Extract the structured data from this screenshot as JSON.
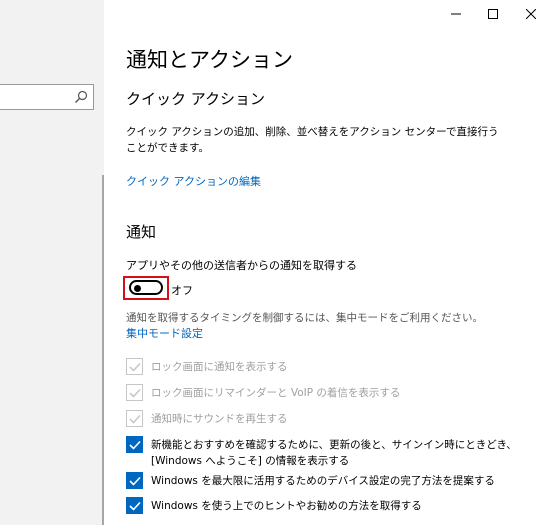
{
  "sidebar": {
    "search_icon": "search-icon"
  },
  "window": {
    "minimize_icon": "minimize-icon",
    "maximize_icon": "maximize-icon",
    "close_icon": "close-icon"
  },
  "page": {
    "title": "通知とアクション"
  },
  "quick_actions": {
    "heading": "クイック アクション",
    "description": "クイック アクションの追加、削除、並べ替えをアクション センターで直接行うことができます。",
    "edit_link": "クイック アクションの編集"
  },
  "notifications": {
    "heading": "通知",
    "toggle_label": "アプリやその他の送信者からの通知を取得する",
    "toggle_state": "オフ",
    "toggle_on": false,
    "focus_hint": "通知を取得するタイミングを制御するには、集中モードをご利用ください。",
    "focus_link": "集中モード設定",
    "options": [
      {
        "label": "ロック画面に通知を表示する",
        "checked": true,
        "enabled": false
      },
      {
        "label": "ロック画面にリマインダーと VoIP の着信を表示する",
        "checked": true,
        "enabled": false
      },
      {
        "label": "通知時にサウンドを再生する",
        "checked": true,
        "enabled": false
      },
      {
        "label": "新機能とおすすめを確認するために、更新の後と、サインイン時にときどき、",
        "label2": "[Windows へようこそ] の情報を表示する",
        "checked": true,
        "enabled": true
      },
      {
        "label": "Windows を最大限に活用するためのデバイス設定の完了方法を提案する",
        "checked": true,
        "enabled": true
      },
      {
        "label": "Windows を使う上でのヒントやお勧めの方法を取得する",
        "checked": true,
        "enabled": true
      }
    ]
  },
  "colors": {
    "accent": "#0067c0",
    "highlight_border": "#d51019",
    "disabled_text": "#a0a0a0"
  }
}
